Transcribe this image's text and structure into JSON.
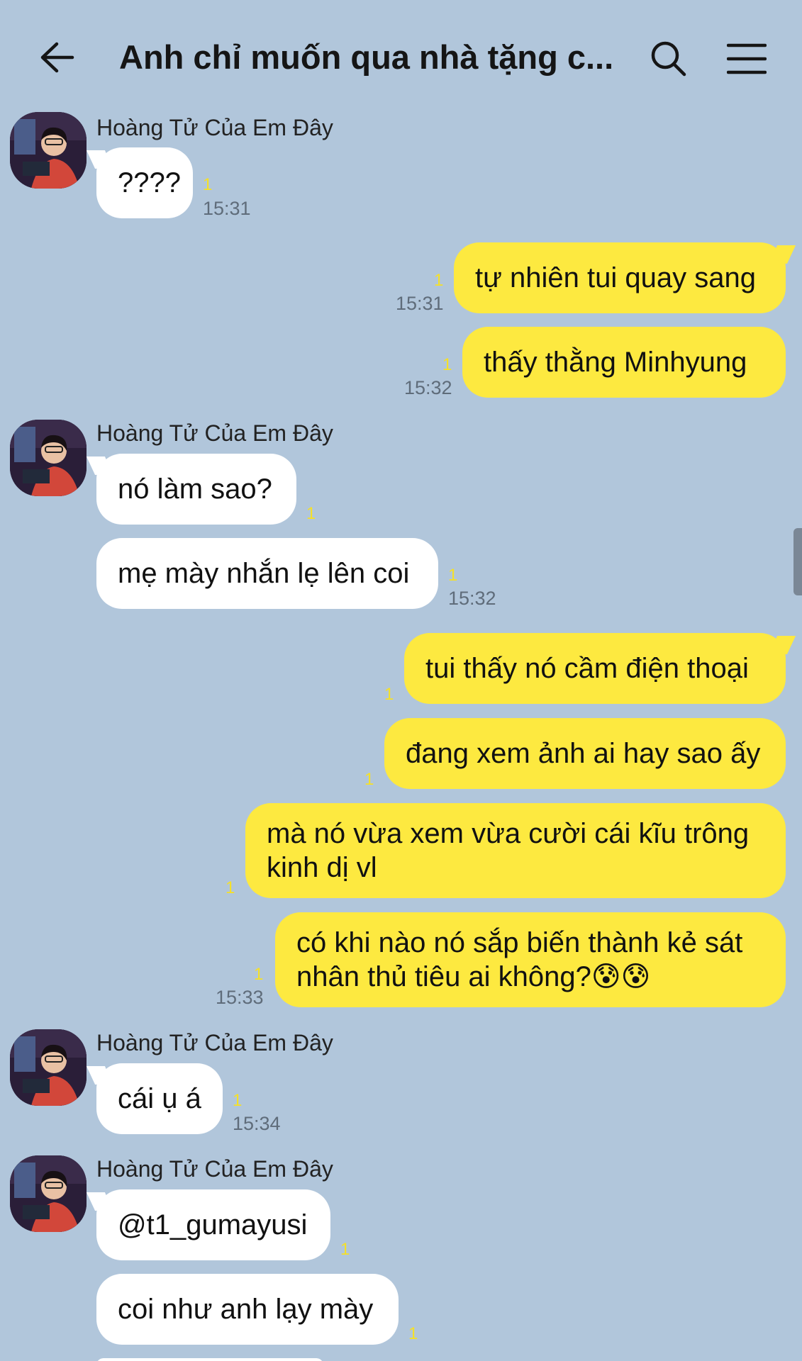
{
  "header": {
    "title": "Anh chỉ muốn qua nhà tặng c..."
  },
  "messages": [
    {
      "sender": "Hoàng Tử Của Em Đây",
      "text": "????",
      "unread": "1",
      "time": "15:31"
    },
    {
      "text": "tự nhiên tui quay sang",
      "unread": "1",
      "time": "15:31"
    },
    {
      "text": "thấy thằng Minhyung",
      "unread": "1",
      "time": "15:32"
    },
    {
      "sender": "Hoàng Tử Của Em Đây",
      "text": "nó làm sao?",
      "unread": "1"
    },
    {
      "text": "mẹ mày nhắn lẹ lên coi",
      "unread": "1",
      "time": "15:32"
    },
    {
      "text": "tui thấy nó cầm điện thoại",
      "unread": "1"
    },
    {
      "text": "đang xem ảnh ai hay sao ấy",
      "unread": "1"
    },
    {
      "text": "mà nó vừa xem vừa cười cái kĩu trông kinh dị vl",
      "unread": "1"
    },
    {
      "text": "có khi nào nó sắp biến thành kẻ sát nhân thủ tiêu ai không?😰😰",
      "unread": "1",
      "time": "15:33"
    },
    {
      "sender": "Hoàng Tử Của Em Đây",
      "text": "cái ụ á",
      "unread": "1",
      "time": "15:34"
    },
    {
      "sender": "Hoàng Tử Của Em Đây",
      "text": "@t1_gumayusi",
      "unread": "1"
    },
    {
      "text": "coi như anh lạy mày",
      "unread": "1"
    }
  ],
  "colors": {
    "background": "#b1c6db",
    "incoming_bubble": "#ffffff",
    "outgoing_bubble": "#fde940",
    "unread_count": "#f5e028",
    "timestamp": "#5f6c7a"
  },
  "icons": {
    "back": "arrow-left-icon",
    "search": "search-icon",
    "menu": "hamburger-menu-icon"
  }
}
